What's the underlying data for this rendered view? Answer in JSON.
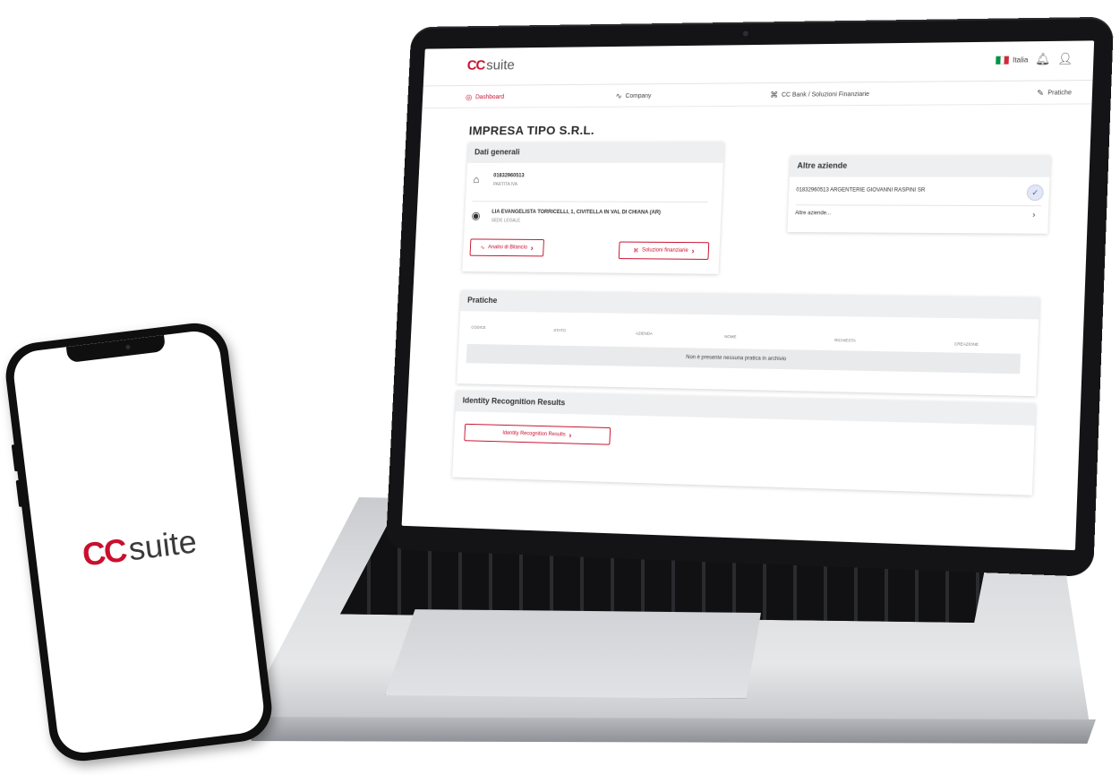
{
  "brand": {
    "cc": "CC",
    "suite": "suite"
  },
  "header": {
    "language": "Italia",
    "bell_icon": "bell-icon",
    "user_icon": "user-icon"
  },
  "nav": {
    "dashboard": "Dashboard",
    "company": "Company",
    "bank": "CC Bank / Soluzioni Finanziarie",
    "pratiche": "Pratiche"
  },
  "company_name": "IMPRESA TIPO S.R.L.",
  "dati_generali": {
    "title": "Dati generali",
    "partita_iva_value": "01832960513",
    "partita_iva_label": "PARTITA IVA",
    "address_value": "LIA EVANGELISTA TORRICELLI, 1, CIVITELLA IN VAL DI CHIANA (AR)",
    "address_label": "SEDE LEGALE",
    "analisi_button": "Analisi di Bilancio",
    "soluzioni_button": "Soluzioni finanziarie"
  },
  "altre_aziende": {
    "title": "Altre aziende",
    "item": "01832960513 ARGENTERIE GIOVANNI RASPINI SR",
    "more": "Altre aziende..."
  },
  "pratiche": {
    "title": "Pratiche",
    "columns": [
      "Codice",
      "Stato",
      "Azienda",
      "Nome",
      "Richiesta",
      "Creazione"
    ],
    "empty": "Non è presente nessuna pratica in archivio"
  },
  "identity": {
    "title": "Identity Recognition Results",
    "button": "Identity Recognition Results"
  },
  "colors": {
    "brand_red": "#c8102e",
    "card_head": "#eeeff1"
  }
}
